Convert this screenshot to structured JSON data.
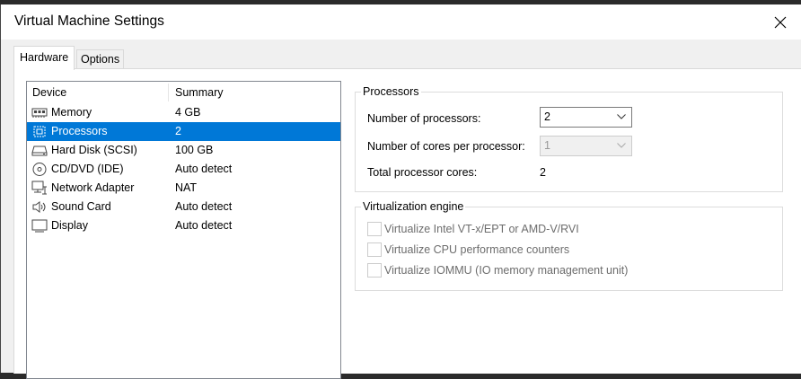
{
  "window": {
    "title": "Virtual Machine Settings"
  },
  "tabs": [
    {
      "label": "Hardware"
    },
    {
      "label": "Options"
    }
  ],
  "device_list": {
    "columns": {
      "device": "Device",
      "summary": "Summary"
    },
    "rows": [
      {
        "icon": "memory-icon",
        "device": "Memory",
        "summary": "4 GB"
      },
      {
        "icon": "processor-icon",
        "device": "Processors",
        "summary": "2",
        "selected": true
      },
      {
        "icon": "hard-disk-icon",
        "device": "Hard Disk (SCSI)",
        "summary": "100 GB"
      },
      {
        "icon": "cd-dvd-icon",
        "device": "CD/DVD (IDE)",
        "summary": "Auto detect"
      },
      {
        "icon": "network-adapter-icon",
        "device": "Network Adapter",
        "summary": "NAT"
      },
      {
        "icon": "sound-card-icon",
        "device": "Sound Card",
        "summary": "Auto detect"
      },
      {
        "icon": "display-icon",
        "device": "Display",
        "summary": "Auto detect"
      }
    ]
  },
  "processors": {
    "group_label": "Processors",
    "num_processors": {
      "label": "Number of processors:",
      "value": "2"
    },
    "cores_per_processor": {
      "label": "Number of cores per processor:",
      "value": "1",
      "disabled": true
    },
    "total_cores": {
      "label": "Total processor cores:",
      "value": "2"
    }
  },
  "virtualization": {
    "group_label": "Virtualization engine",
    "options": [
      {
        "label": "Virtualize Intel VT-x/EPT or AMD-V/RVI",
        "checked": false,
        "disabled": true
      },
      {
        "label": "Virtualize CPU performance counters",
        "checked": false,
        "disabled": true
      },
      {
        "label": "Virtualize IOMMU (IO memory management unit)",
        "checked": false,
        "disabled": true
      }
    ]
  },
  "colors": {
    "selection": "#0078d7",
    "disabled_text": "#6d6d6d"
  }
}
